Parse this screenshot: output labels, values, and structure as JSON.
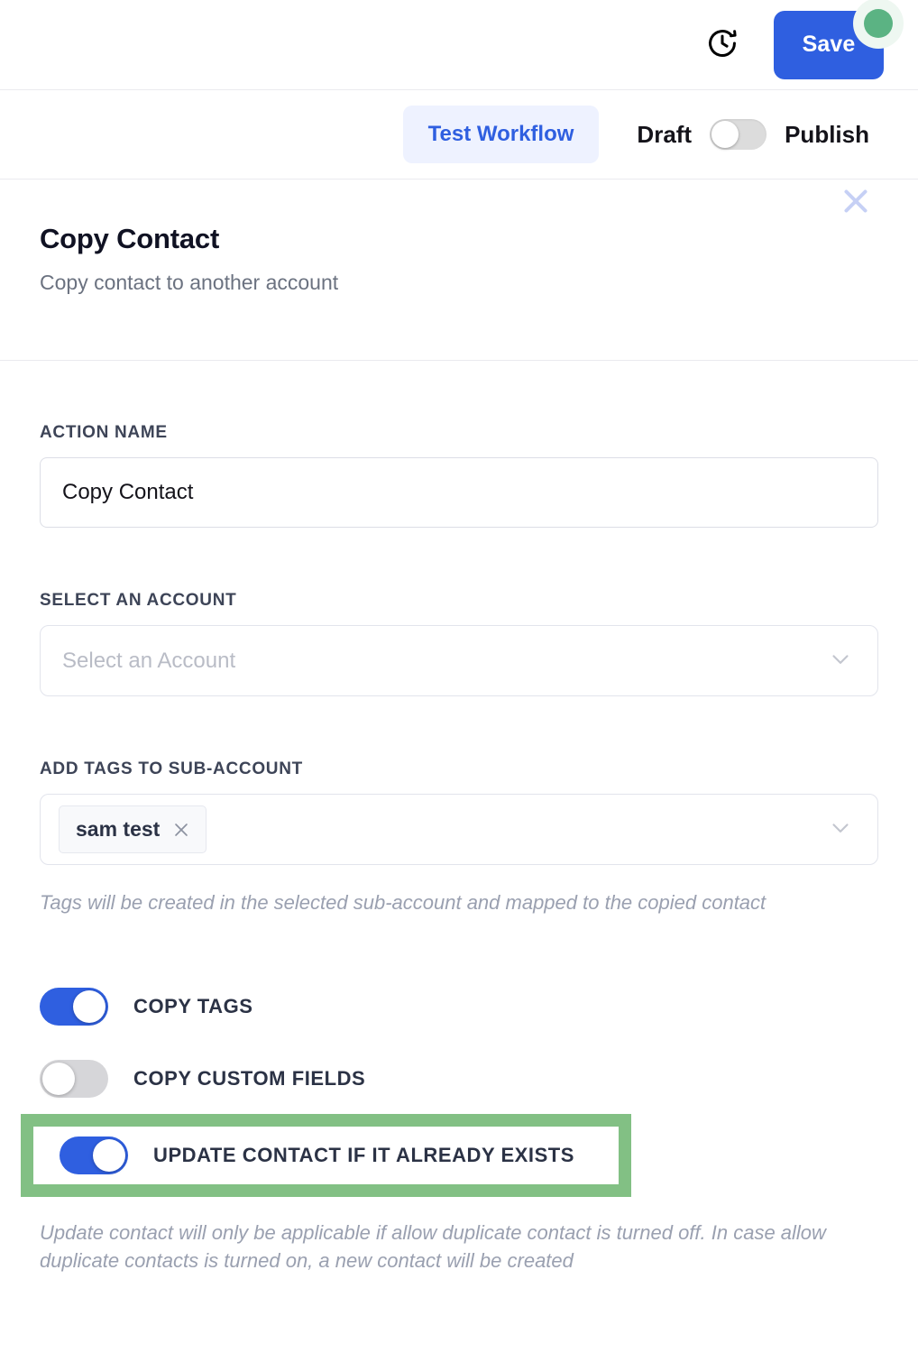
{
  "topbar": {
    "history_icon": "clock-history-icon",
    "save_label": "Save",
    "status_dot_color": "#5bb383",
    "save_bg_color": "#2f5fe0"
  },
  "tabbar": {
    "test_workflow_label": "Test Workflow",
    "draft_label": "Draft",
    "publish_label": "Publish",
    "publish_state": "off"
  },
  "panel": {
    "title": "Copy Contact",
    "subtitle": "Copy contact to another account",
    "close_icon": "close-icon",
    "close_icon_color": "#c6d0f5"
  },
  "form": {
    "action_name": {
      "label": "ACTION NAME",
      "value": "Copy Contact",
      "placeholder": "Action Name"
    },
    "account": {
      "label": "SELECT AN ACCOUNT",
      "value": "",
      "placeholder": "Select an Account",
      "chevron_icon": "chevron-down-icon"
    },
    "tags": {
      "label": "ADD TAGS TO SUB-ACCOUNT",
      "chips": [
        "sam test"
      ],
      "chip_remove_icon": "close-icon",
      "chevron_icon": "chevron-down-icon",
      "helper": "Tags will be created in the selected sub-account and mapped to the copied contact"
    }
  },
  "toggles": [
    {
      "label": "COPY TAGS",
      "state": "on",
      "highlighted": false
    },
    {
      "label": "COPY CUSTOM FIELDS",
      "state": "off",
      "highlighted": false
    },
    {
      "label": "UPDATE CONTACT IF IT ALREADY EXISTS",
      "state": "on",
      "highlighted": true
    }
  ],
  "toggle_helper": "Update contact will only be applicable if allow duplicate contact is turned off. In case allow duplicate contacts is turned on, a new contact will be created",
  "colors": {
    "accent_blue": "#2f5fe0",
    "highlight_green": "#82c084",
    "divider": "#eaeaef",
    "muted_text": "#9aa0b0"
  }
}
